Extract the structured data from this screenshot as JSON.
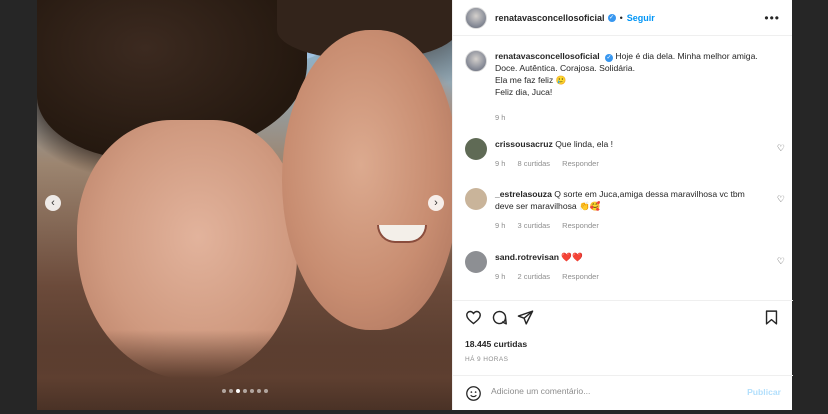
{
  "post": {
    "author": "renatavasconcellosoficial",
    "separator": "•",
    "follow_label": "Seguir",
    "more_label": "•••",
    "caption_lines": [
      "Hoje é dia dela. Minha melhor amiga.",
      "Doce. Autêntica. Corajosa. Solidária.",
      "Ela me faz feliz 🥲",
      "Feliz dia, Juca!"
    ],
    "caption_time": "9 h",
    "carousel": {
      "total": 7,
      "active": 2
    }
  },
  "comments": [
    {
      "user": "crissousacruz",
      "text": "Que linda, ela !",
      "time": "9 h",
      "likes": "8 curtidas",
      "reply": "Responder",
      "avatar_color": "#5f6a55"
    },
    {
      "user": "_estrelasouza",
      "text": "Q sorte em Juca,amiga dessa maravilhosa vc tbm deve ser maravilhosa 👏🥰",
      "time": "9 h",
      "likes": "3 curtidas",
      "reply": "Responder",
      "avatar_color": "#c9b49a"
    },
    {
      "user": "sand.rotrevisan",
      "text": "❤️❤️",
      "time": "9 h",
      "likes": "2 curtidas",
      "reply": "Responder",
      "avatar_color": "#8d8f93"
    }
  ],
  "footer": {
    "likes": "18.445 curtidas",
    "posted_ago": "HÁ 9 HORAS",
    "comment_placeholder": "Adicione um comentário...",
    "publish_label": "Publicar"
  },
  "icons": [
    "heart-icon",
    "comment-icon",
    "share-icon",
    "bookmark-icon",
    "emoji-icon",
    "chevron-left-icon",
    "chevron-right-icon",
    "verified-icon"
  ]
}
